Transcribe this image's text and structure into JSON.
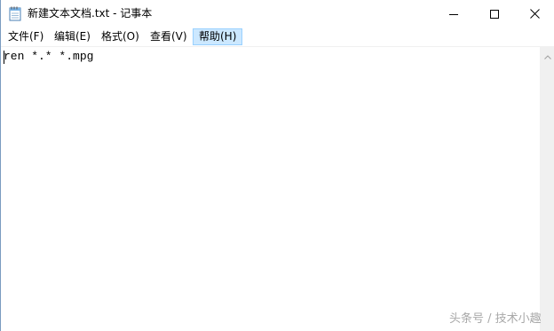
{
  "window": {
    "title": "新建文本文档.txt - 记事本",
    "icon": "notepad-icon",
    "controls": {
      "minimize_icon": "minimize-icon",
      "maximize_icon": "maximize-icon",
      "close_icon": "close-icon"
    }
  },
  "menu": {
    "items": [
      {
        "label": "文件(F)"
      },
      {
        "label": "编辑(E)"
      },
      {
        "label": "格式(O)"
      },
      {
        "label": "查看(V)"
      },
      {
        "label": "帮助(H)",
        "active": true
      }
    ]
  },
  "editor": {
    "content": "ren *.* *.mpg"
  },
  "watermark": {
    "text": "头条号 / 技术小趣"
  },
  "colors": {
    "menu_active_bg": "#cce8ff",
    "menu_active_border": "#99d1ff",
    "scrollbar_bg": "#f0f0f0"
  }
}
